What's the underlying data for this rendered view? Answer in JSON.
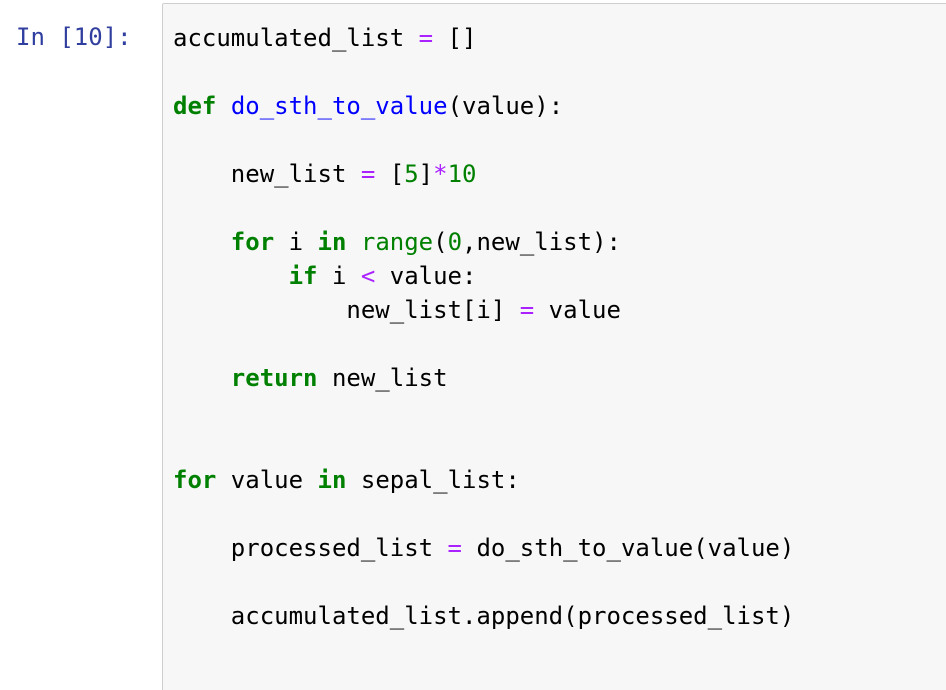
{
  "cell": {
    "prompt": "In [10]:",
    "colors": {
      "prompt": "#303f9f",
      "keyword": "#008000",
      "function_name": "#0000ff",
      "operator": "#aa22ff",
      "number": "#008000",
      "background": "#f7f7f7",
      "border": "#cfcfcf"
    },
    "code_lines": [
      [
        {
          "t": "accumulated_list ",
          "c": "nm"
        },
        {
          "t": "=",
          "c": "op"
        },
        {
          "t": " []",
          "c": "nm"
        }
      ],
      [],
      [
        {
          "t": "def",
          "c": "kw"
        },
        {
          "t": " ",
          "c": "nm"
        },
        {
          "t": "do_sth_to_value",
          "c": "fn"
        },
        {
          "t": "(value):",
          "c": "nm"
        }
      ],
      [],
      [
        {
          "t": "    new_list ",
          "c": "nm"
        },
        {
          "t": "=",
          "c": "op"
        },
        {
          "t": " [",
          "c": "nm"
        },
        {
          "t": "5",
          "c": "num"
        },
        {
          "t": "]",
          "c": "nm"
        },
        {
          "t": "*",
          "c": "op"
        },
        {
          "t": "10",
          "c": "num"
        }
      ],
      [],
      [
        {
          "t": "    ",
          "c": "nm"
        },
        {
          "t": "for",
          "c": "kw"
        },
        {
          "t": " i ",
          "c": "nm"
        },
        {
          "t": "in",
          "c": "kw"
        },
        {
          "t": " ",
          "c": "nm"
        },
        {
          "t": "range",
          "c": "bi"
        },
        {
          "t": "(",
          "c": "nm"
        },
        {
          "t": "0",
          "c": "num"
        },
        {
          "t": ",new_list):",
          "c": "nm"
        }
      ],
      [
        {
          "t": "        ",
          "c": "nm"
        },
        {
          "t": "if",
          "c": "kw"
        },
        {
          "t": " i ",
          "c": "nm"
        },
        {
          "t": "<",
          "c": "op"
        },
        {
          "t": " value:",
          "c": "nm"
        }
      ],
      [
        {
          "t": "            new_list[i] ",
          "c": "nm"
        },
        {
          "t": "=",
          "c": "op"
        },
        {
          "t": " value",
          "c": "nm"
        }
      ],
      [],
      [
        {
          "t": "    ",
          "c": "nm"
        },
        {
          "t": "return",
          "c": "kw"
        },
        {
          "t": " new_list",
          "c": "nm"
        }
      ],
      [],
      [],
      [
        {
          "t": "for",
          "c": "kw"
        },
        {
          "t": " value ",
          "c": "nm"
        },
        {
          "t": "in",
          "c": "kw"
        },
        {
          "t": " sepal_list:",
          "c": "nm"
        }
      ],
      [],
      [
        {
          "t": "    processed_list ",
          "c": "nm"
        },
        {
          "t": "=",
          "c": "op"
        },
        {
          "t": " do_sth_to_value(value)",
          "c": "nm"
        }
      ],
      [],
      [
        {
          "t": "    accumulated_list.append(processed_list)",
          "c": "nm"
        }
      ],
      []
    ]
  }
}
